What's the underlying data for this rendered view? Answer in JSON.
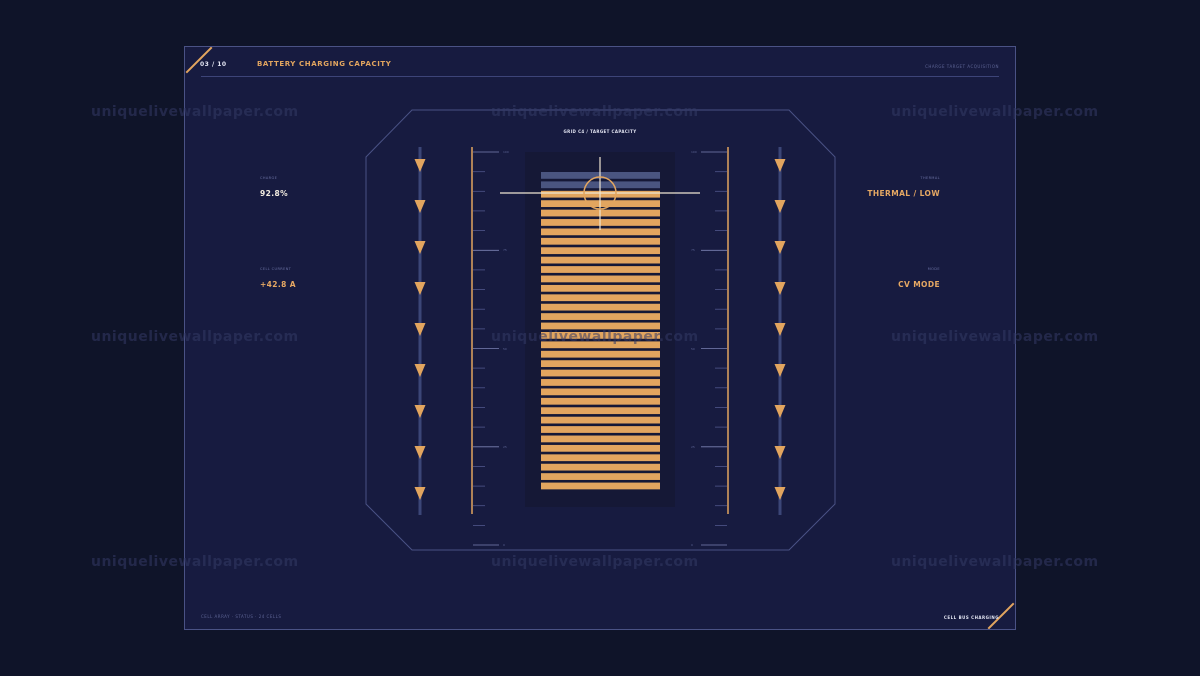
{
  "header": {
    "page_indicator": "03 / 10",
    "title": "BATTERY CHARGING CAPACITY",
    "right_label": "CHARGE TARGET ACQUISITION"
  },
  "chart": {
    "title": "GRID C4 / TARGET CAPACITY"
  },
  "left_stats": [
    {
      "label": "CHARGE",
      "value": "92.8%"
    },
    {
      "label": "CELL CURRENT",
      "value": "+42.8 A"
    }
  ],
  "right_stats": [
    {
      "label": "THERMAL",
      "value": "THERMAL / LOW"
    },
    {
      "label": "MODE",
      "value": "CV MODE"
    }
  ],
  "footer": {
    "left_label": "CELL ARRAY · STATUS · 24 CELLS",
    "right_label": "CELL BUS CHARGING"
  },
  "battery": {
    "total_cells": 34,
    "empty_cells": 2,
    "charge_percent": 92.8
  },
  "scale": {
    "left_labels": [
      "100",
      "75",
      "50",
      "25",
      "0"
    ],
    "right_labels": [
      "100",
      "75",
      "50",
      "25",
      "0"
    ]
  },
  "watermark_text": "uniquelivewallpaper.com",
  "colors": {
    "accent": "#e2a55f",
    "empty_cell": "#4a5580",
    "frame_line": "#4a5285",
    "arrow_track": "#3b4677"
  }
}
